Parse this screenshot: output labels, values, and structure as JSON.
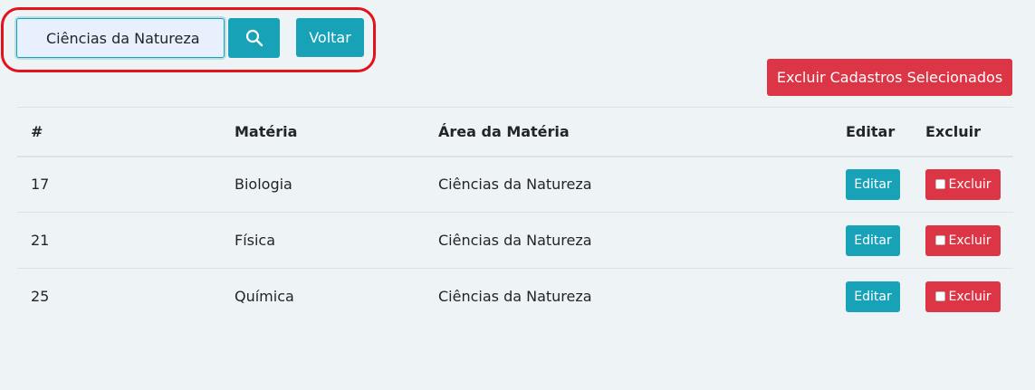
{
  "search": {
    "value": "Ciências da Natureza"
  },
  "buttons": {
    "voltar": "Voltar",
    "excluir_selecionados": "Excluir Cadastros Selecionados"
  },
  "table": {
    "headers": {
      "id": "#",
      "materia": "Matéria",
      "area": "Área da Matéria",
      "editar": "Editar",
      "excluir": "Excluir"
    },
    "rows": [
      {
        "id": "17",
        "materia": "Biologia",
        "area": "Ciências da Natureza",
        "edit_label": "Editar",
        "delete_label": "Excluir"
      },
      {
        "id": "21",
        "materia": "Física",
        "area": "Ciências da Natureza",
        "edit_label": "Editar",
        "delete_label": "Excluir"
      },
      {
        "id": "25",
        "materia": "Química",
        "area": "Ciências da Natureza",
        "edit_label": "Editar",
        "delete_label": "Excluir"
      }
    ]
  },
  "colors": {
    "info": "#17a2b8",
    "danger": "#dc3545",
    "highlight": "#e3121b",
    "background": "#eef3f6"
  },
  "icons": {
    "search_button": "search-icon",
    "row_checkbox": "checkbox-icon"
  }
}
